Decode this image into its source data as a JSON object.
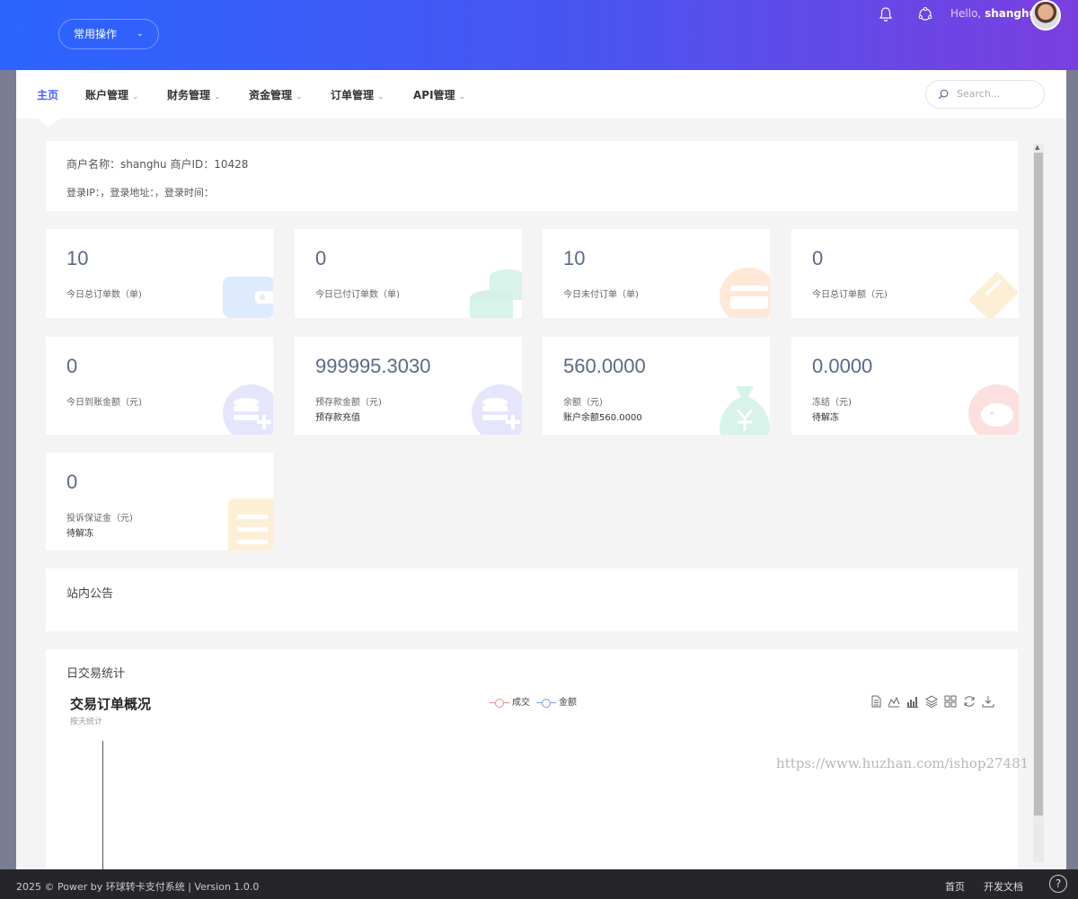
{
  "header": {
    "quick_ops_label": "常用操作",
    "hello_prefix": "Hello,",
    "username": "shanghu"
  },
  "nav": {
    "items": [
      {
        "label": "主页"
      },
      {
        "label": "账户管理"
      },
      {
        "label": "财务管理"
      },
      {
        "label": "资金管理"
      },
      {
        "label": "订单管理"
      },
      {
        "label": "API管理"
      }
    ],
    "search_placeholder": "Search..."
  },
  "merchant": {
    "line1": "商户名称：shanghu  商户ID：10428",
    "line2": "登录IP：，登录地址：，登录时间："
  },
  "stats": [
    {
      "value": "10",
      "label": "今日总订单数（单)",
      "sub": "",
      "icon": "wallet-icon",
      "color": "#3b82f6"
    },
    {
      "value": "0",
      "label": "今日已付订单数（单)",
      "sub": "",
      "icon": "coins-icon",
      "color": "#10b981"
    },
    {
      "value": "10",
      "label": "今日未付订单（单)",
      "sub": "",
      "icon": "card-icon",
      "color": "#f97316"
    },
    {
      "value": "0",
      "label": "今日总订单额（元)",
      "sub": "",
      "icon": "ticket-icon",
      "color": "#f59e0b"
    },
    {
      "value": "0",
      "label": "今日到账金额（元)",
      "sub": "",
      "icon": "database-plus-icon",
      "color": "#6366f1"
    },
    {
      "value": "999995.3030",
      "label": "预存款金额（元)",
      "sub": "预存款充值",
      "icon": "database-plus-icon",
      "color": "#6366f1"
    },
    {
      "value": "560.0000",
      "label": "余额（元)",
      "sub": "账户余额560.0000",
      "icon": "money-bag-icon",
      "color": "#10b981"
    },
    {
      "value": "0.0000",
      "label": "冻结（元)",
      "sub": "待解冻",
      "icon": "piggy-bank-icon",
      "color": "#ef4444"
    },
    {
      "value": "0",
      "label": "投诉保证金（元)",
      "sub": "待解冻",
      "icon": "receipt-icon",
      "color": "#f59e0b"
    }
  ],
  "notice": {
    "title": "站内公告"
  },
  "daily": {
    "title": "日交易统计",
    "chart_title": "交易订单概况",
    "chart_subtitle": "按天统计",
    "legend": [
      {
        "name": "成交",
        "color": "#e98a8a"
      },
      {
        "name": "金额",
        "color": "#7a9ce8"
      }
    ],
    "toolbox_icons": [
      "data-view-icon",
      "line-chart-icon",
      "bar-chart-icon",
      "stack-icon",
      "tiled-icon",
      "refresh-icon",
      "download-icon"
    ]
  },
  "watermark": "https://www.huzhan.com/ishop27481",
  "footer": {
    "copyright": "2025 © Power by 环球转卡支付系统 | Version 1.0.0",
    "link_home": "首页",
    "link_docs": "开发文档",
    "help": "?"
  }
}
